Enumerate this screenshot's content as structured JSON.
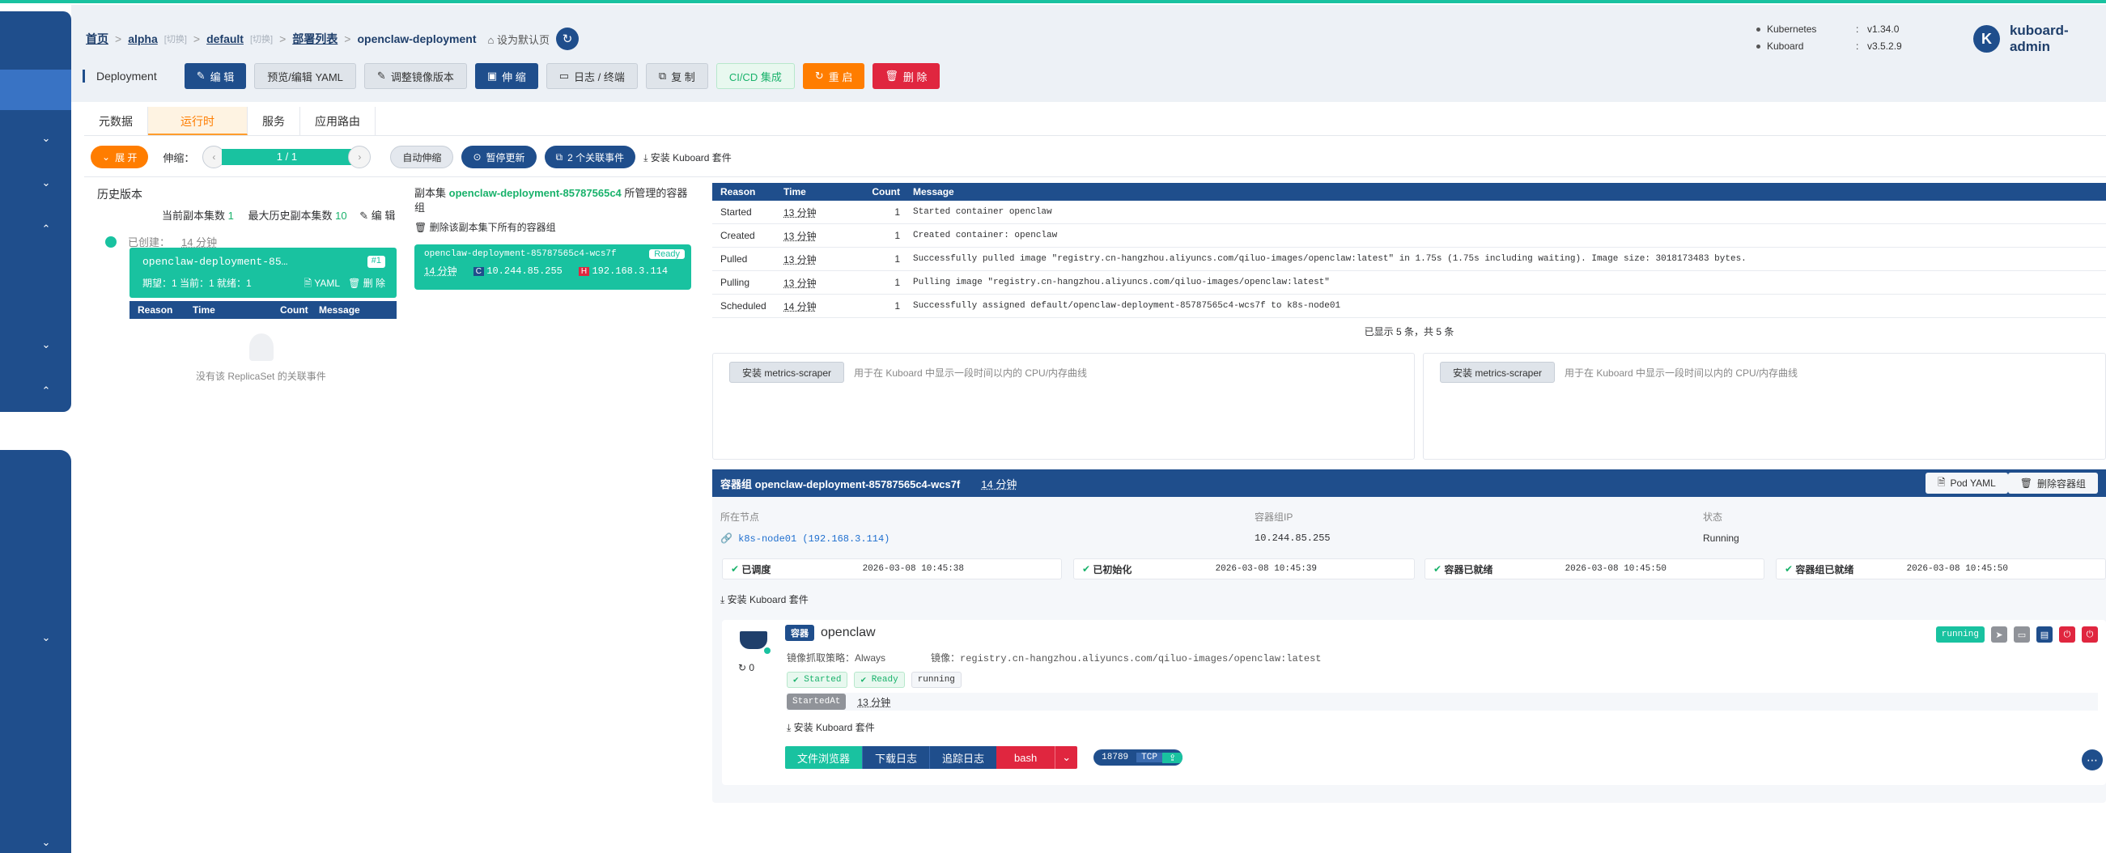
{
  "breadcrumb": {
    "home": "首页",
    "cluster": "alpha",
    "cluster_switch": "[切换]",
    "namespace": "default",
    "namespace_switch": "[切换]",
    "workloads": "部署列表",
    "current": "openclaw-deployment",
    "set_default": "设为默认页"
  },
  "versions": {
    "kubernetes_label": "Kubernetes",
    "kubernetes_value": "v1.34.0",
    "kuboard_label": "Kuboard",
    "kuboard_value": "v3.5.2.9"
  },
  "brand": {
    "logo_letter": "K",
    "name": "kuboard-admin"
  },
  "toolbar": {
    "type_label": "Deployment",
    "edit": "编 辑",
    "preview_yaml": "预览/编辑 YAML",
    "adjust_image": "调整镜像版本",
    "scale": "伸 缩",
    "logs": "日志 / 终端",
    "copy": "复 制",
    "cicd": "CI/CD 集成",
    "restart": "重 启",
    "delete": "删 除"
  },
  "tabs": [
    "元数据",
    "运行时",
    "服务",
    "应用路由"
  ],
  "controls": {
    "expand": "展 开",
    "scale_label": "伸缩：",
    "replicas": "1 / 1",
    "autoscale": "自动伸缩",
    "pause_update": "暂停更新",
    "related_events": "2 个关联事件",
    "install_suite": "安装 Kuboard 套件"
  },
  "history": {
    "title": "历史版本",
    "current_replicasets_label": "当前副本集数",
    "current_replicasets_value": "1",
    "max_history_label": "最大历史副本集数",
    "max_history_value": "10",
    "edit": "编 辑",
    "created_label": "已创建：",
    "created_value": "14 分钟",
    "rs_name": "openclaw-deployment-85…",
    "rs_badge": "#1",
    "rs_status": "期望：1 当前：1 就绪：1",
    "rs_yaml": "YAML",
    "rs_delete": "删 除",
    "table_headers": [
      "Reason",
      "Time",
      "Count",
      "Message"
    ],
    "empty_text": "没有该 ReplicaSet 的关联事件"
  },
  "replicaset": {
    "prefix": "副本集",
    "name": "openclaw-deployment-85787565c4",
    "suffix": "所管理的容器组",
    "delete_all": "删除该副本集下所有的容器组",
    "pod_name": "openclaw-deployment-85787565c4-wcs7f",
    "pod_ready": "Ready",
    "pod_age": "14 分钟",
    "pod_ip_badge": "C",
    "pod_ip": "10.244.85.255",
    "host_ip_badge": "H",
    "host_ip": "192.168.3.114"
  },
  "events": {
    "headers": [
      "Reason",
      "Time",
      "Count",
      "Message"
    ],
    "rows": [
      {
        "reason": "Started",
        "time": "13 分钟",
        "count": "1",
        "message": "Started container openclaw"
      },
      {
        "reason": "Created",
        "time": "13 分钟",
        "count": "1",
        "message": "Created container: openclaw"
      },
      {
        "reason": "Pulled",
        "time": "13 分钟",
        "count": "1",
        "message": "Successfully pulled image \"registry.cn-hangzhou.aliyuncs.com/qiluo-images/openclaw:latest\" in 1.75s (1.75s including waiting). Image size: 3018173483 bytes."
      },
      {
        "reason": "Pulling",
        "time": "13 分钟",
        "count": "1",
        "message": "Pulling image \"registry.cn-hangzhou.aliyuncs.com/qiluo-images/openclaw:latest\""
      },
      {
        "reason": "Scheduled",
        "time": "14 分钟",
        "count": "1",
        "message": "Successfully assigned default/openclaw-deployment-85787565c4-wcs7f to k8s-node01"
      }
    ],
    "footer": "已显示 5 条，共 5 条"
  },
  "metrics": {
    "button": "安装 metrics-scraper",
    "hint": "用于在 Kuboard 中显示一段时间以内的 CPU/内存曲线"
  },
  "pod": {
    "title_label": "容器组",
    "name": "openclaw-deployment-85787565c4-wcs7f",
    "age": "14 分钟",
    "pod_yaml": "Pod YAML",
    "delete_pod": "删除容器组",
    "node_label": "所在节点",
    "node_value": "k8s-node01 (192.168.3.114)",
    "ip_label": "容器组IP",
    "ip_value": "10.244.85.255",
    "status_label": "状态",
    "status_value": "Running",
    "conditions": [
      {
        "label": "已调度",
        "time": "2026-03-08 10:45:38"
      },
      {
        "label": "已初始化",
        "time": "2026-03-08 10:45:39"
      },
      {
        "label": "容器已就绪",
        "time": "2026-03-08 10:45:50"
      },
      {
        "label": "容器组已就绪",
        "time": "2026-03-08 10:45:50"
      }
    ],
    "install_suite": "安装 Kuboard 套件"
  },
  "container": {
    "tag": "容器",
    "name": "openclaw",
    "restart_count": "0",
    "pull_policy": "镜像抓取策略：Always",
    "image": "镜像：registry.cn-hangzhou.aliyuncs.com/qiluo-images/openclaw:latest",
    "state_started": "Started",
    "state_ready": "Ready",
    "state_running": "running",
    "started_at_label": "StartedAt",
    "started_at_value": "13 分钟",
    "status_badge": "running",
    "install_suite": "安装 Kuboard 套件",
    "file_browser": "文件浏览器",
    "download_logs": "下载日志",
    "tail_logs": "追踪日志",
    "bash": "bash",
    "port": "18789",
    "protocol": "TCP"
  },
  "colors": {
    "primary": "#1f4e8c",
    "accent_green": "#19c2a0",
    "orange": "#ff7d00",
    "red": "#e0263f"
  }
}
